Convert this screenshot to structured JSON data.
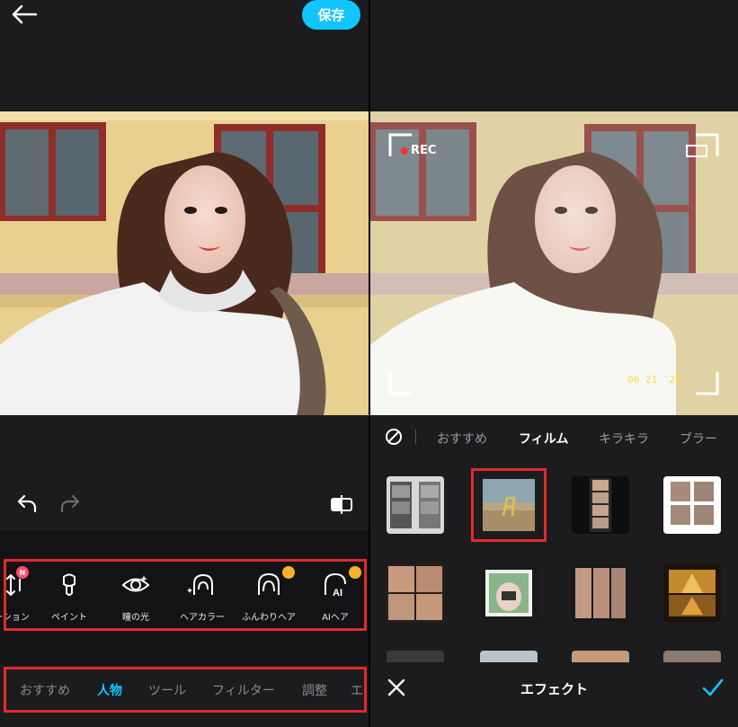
{
  "left": {
    "header": {
      "save_label": "保存",
      "back_icon": "arrow-left-icon"
    },
    "history": {
      "undo_icon": "undo-icon",
      "redo_icon": "redo-icon",
      "compare_icon": "compare-icon"
    },
    "tools": [
      {
        "label": "ーション",
        "icon": "motion-icon",
        "badge": "N"
      },
      {
        "label": "ペイント",
        "icon": "paint-brush-icon",
        "badge": ""
      },
      {
        "label": "瞳の光",
        "icon": "eye-light-icon",
        "badge": ""
      },
      {
        "label": "ヘアカラー",
        "icon": "hair-color-icon",
        "badge": ""
      },
      {
        "label": "ふんわりヘア",
        "icon": "fluffy-hair-icon",
        "badge": "crown"
      },
      {
        "label": "AIヘア",
        "icon": "ai-hair-icon",
        "badge": "crown"
      }
    ],
    "categories": [
      {
        "label": "おすすめ",
        "active": false
      },
      {
        "label": "人物",
        "active": true
      },
      {
        "label": "ツール",
        "active": false
      },
      {
        "label": "フィルター",
        "active": false
      },
      {
        "label": "調整",
        "active": false
      },
      {
        "label": "エ",
        "active": false
      }
    ]
  },
  "right": {
    "photo_overlay": {
      "rec_label": "REC",
      "resolution_label": "FULL HD",
      "date_label": "06 21 '20"
    },
    "effect_categories": [
      {
        "label": "おすすめ",
        "active": false
      },
      {
        "label": "フィルム",
        "active": true
      },
      {
        "label": "キラキラ",
        "active": false
      },
      {
        "label": "ブラー",
        "active": false
      }
    ],
    "effects_grid": [
      {
        "name": "film-strip-bw",
        "selected": false
      },
      {
        "name": "beach-chair-film",
        "selected": true
      },
      {
        "name": "vertical-film-strip",
        "selected": false
      },
      {
        "name": "four-portrait-grid",
        "selected": false
      },
      {
        "name": "portrait-collage",
        "selected": false
      },
      {
        "name": "camera-frame",
        "selected": false
      },
      {
        "name": "triple-portrait",
        "selected": false
      },
      {
        "name": "movie-poster",
        "selected": false
      }
    ],
    "bottom_bar": {
      "title": "エフェクト",
      "close_icon": "close-icon",
      "confirm_icon": "check-icon"
    }
  },
  "colors": {
    "accent": "#12c5ff",
    "highlight": "#e22a2a",
    "panel_bg": "#1c1c1e",
    "badge_new": "#ff4d6a",
    "badge_premium": "#f6b12b"
  }
}
